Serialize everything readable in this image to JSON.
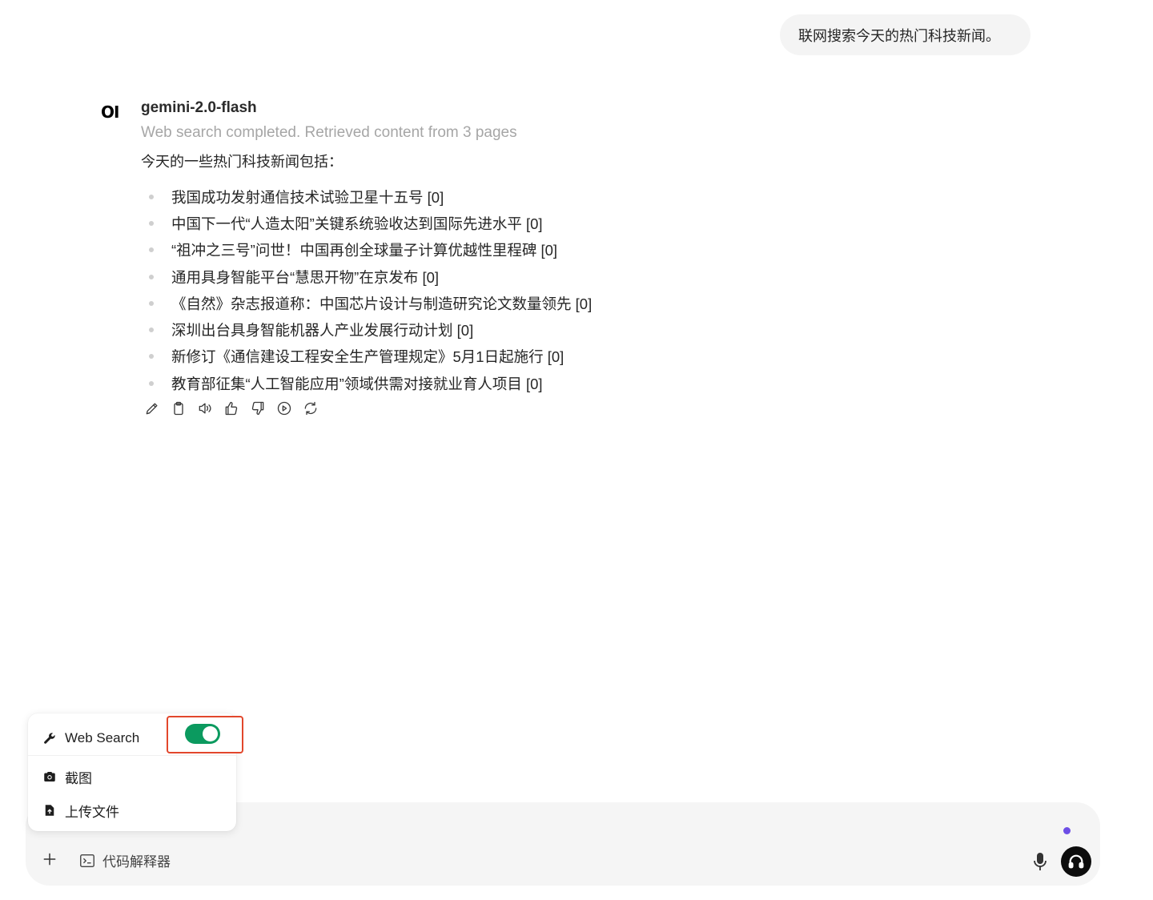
{
  "user_message": {
    "text": "联网搜索今天的热门科技新闻。"
  },
  "assistant": {
    "logo_text": "OI",
    "model_name": "gemini-2.0-flash",
    "status": "Web search completed. Retrieved content from 3 pages",
    "intro": "今天的一些热门科技新闻包括：",
    "news": [
      "我国成功发射通信技术试验卫星十五号 [0]",
      "中国下一代“人造太阳”关键系统验收达到国际先进水平 [0]",
      "“祖冲之三号”问世！中国再创全球量子计算优越性里程碑 [0]",
      "通用具身智能平台“慧思开物”在京发布 [0]",
      "《自然》杂志报道称：中国芯片设计与制造研究论文数量领先 [0]",
      "深圳出台具身智能机器人产业发展行动计划 [0]",
      "新修订《通信建设工程安全生产管理规定》5月1日起施行 [0]",
      "教育部征集“人工智能应用”领域供需对接就业育人项目 [0]"
    ],
    "actions": [
      "edit-icon",
      "copy-icon",
      "read-aloud-icon",
      "thumbs-up-icon",
      "thumbs-down-icon",
      "play-icon",
      "regenerate-icon"
    ]
  },
  "tools_menu": {
    "web_search_label": "Web Search",
    "web_search_enabled": true,
    "screenshot_label": "截图",
    "upload_label": "上传文件"
  },
  "composer": {
    "code_interpreter_label": "代码解释器"
  },
  "colors": {
    "toggle_on": "#0b9a5f",
    "highlight_border": "#e2472c",
    "indicator_dot": "#6d4ee6"
  }
}
